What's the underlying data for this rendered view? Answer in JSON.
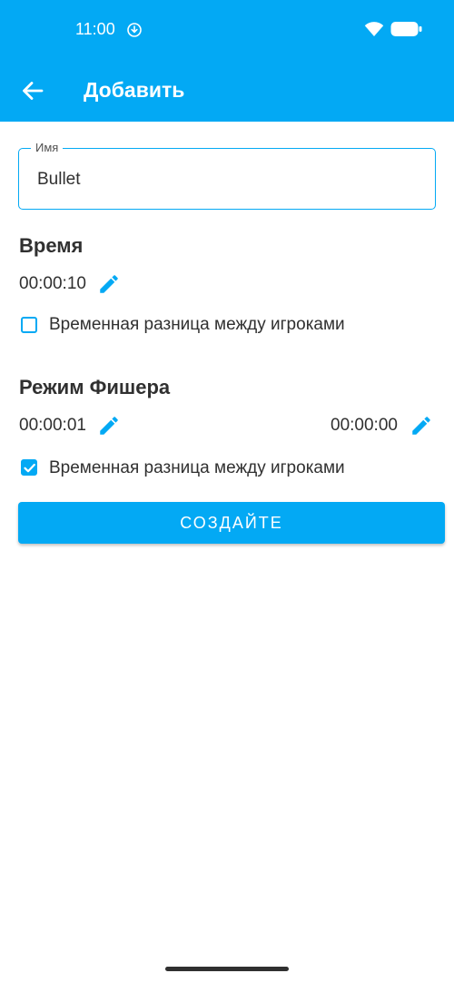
{
  "status_bar": {
    "time": "11:00",
    "icons": [
      "download-circle-icon",
      "wifi-icon",
      "battery-icon"
    ]
  },
  "toolbar": {
    "back_icon": "arrow-left-icon",
    "title": "Добавить"
  },
  "name_field": {
    "label": "Имя",
    "value": "Bullet"
  },
  "time_section": {
    "title": "Время",
    "time": "00:00:10",
    "edit_icon": "pencil-icon",
    "checkbox_label": "Временная разница между игроками",
    "checkbox_checked": false
  },
  "fischer_section": {
    "title": "Режим Фишера",
    "time_left": "00:00:01",
    "time_right": "00:00:00",
    "edit_icon": "pencil-icon",
    "checkbox_label": "Временная разница между игроками",
    "checkbox_checked": true
  },
  "create_button": {
    "label": "СОЗДАЙТЕ"
  },
  "colors": {
    "accent": "#03a9f4",
    "text": "#303030",
    "background": "#ffffff"
  }
}
